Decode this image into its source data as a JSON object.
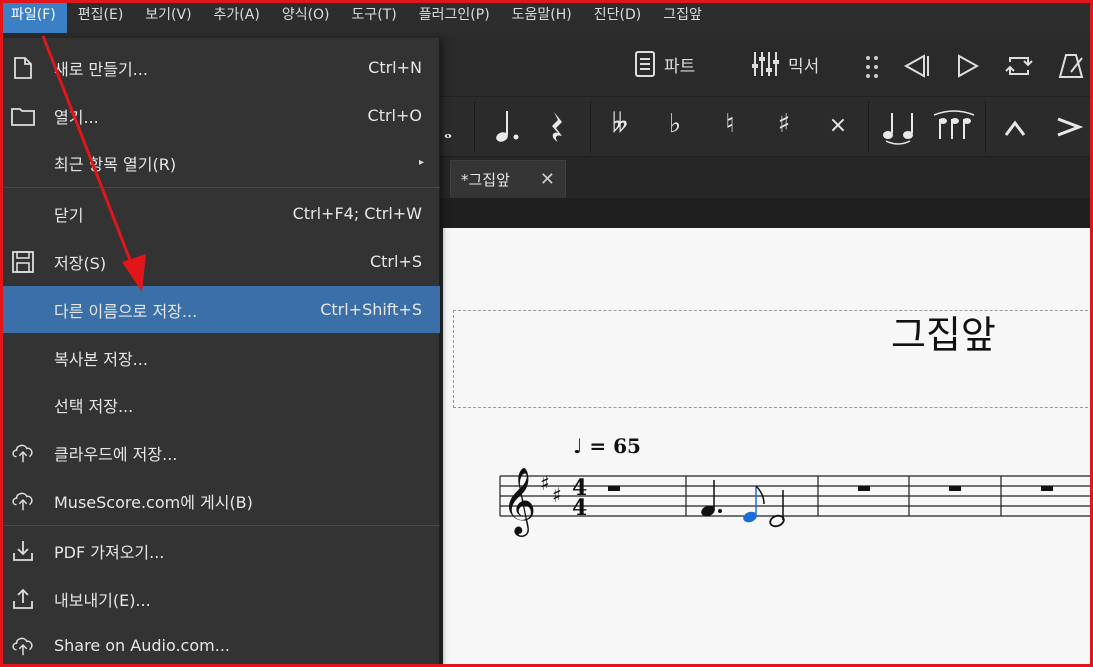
{
  "menubar": {
    "items": [
      "파일(F)",
      "편집(E)",
      "보기(V)",
      "추가(A)",
      "양식(O)",
      "도구(T)",
      "플러그인(P)",
      "도움말(H)",
      "진단(D)",
      "그집앞"
    ]
  },
  "toolbar": {
    "parts_label": "파트",
    "mixer_label": "믹서"
  },
  "tab": {
    "label": "*그집앞"
  },
  "file_menu": {
    "items": [
      {
        "label": "새로 만들기...",
        "shortcut": "Ctrl+N",
        "icon": "new-file-icon"
      },
      {
        "label": "열기...",
        "shortcut": "Ctrl+O",
        "icon": "folder-icon"
      },
      {
        "label": "최근 항목 열기(R)",
        "shortcut": "",
        "icon": "",
        "submenu": "▸"
      },
      {
        "label": "닫기",
        "shortcut": "Ctrl+F4; Ctrl+W",
        "icon": ""
      },
      {
        "label": "저장(S)",
        "shortcut": "Ctrl+S",
        "icon": "save-icon"
      },
      {
        "label": "다른 이름으로 저장...",
        "shortcut": "Ctrl+Shift+S",
        "icon": ""
      },
      {
        "label": "복사본 저장...",
        "shortcut": "",
        "icon": ""
      },
      {
        "label": "선택 저장...",
        "shortcut": "",
        "icon": ""
      },
      {
        "label": "클라우드에 저장...",
        "shortcut": "",
        "icon": "cloud-upload-icon"
      },
      {
        "label": "MuseScore.com에 게시(B)",
        "shortcut": "",
        "icon": "cloud-upload-icon"
      },
      {
        "label": "PDF 가져오기...",
        "shortcut": "",
        "icon": "import-icon"
      },
      {
        "label": "내보내기(E)...",
        "shortcut": "",
        "icon": "export-icon"
      },
      {
        "label": "Share on Audio.com...",
        "shortcut": "",
        "icon": "cloud-share-icon"
      }
    ]
  },
  "score": {
    "title": "그집앞",
    "tempo_value": "= 65"
  },
  "colors": {
    "highlight": "#3b6fa8",
    "menubar_active": "#3b7fc4",
    "annotation_red": "#e0161b",
    "selected_note": "#1a6fd6"
  }
}
